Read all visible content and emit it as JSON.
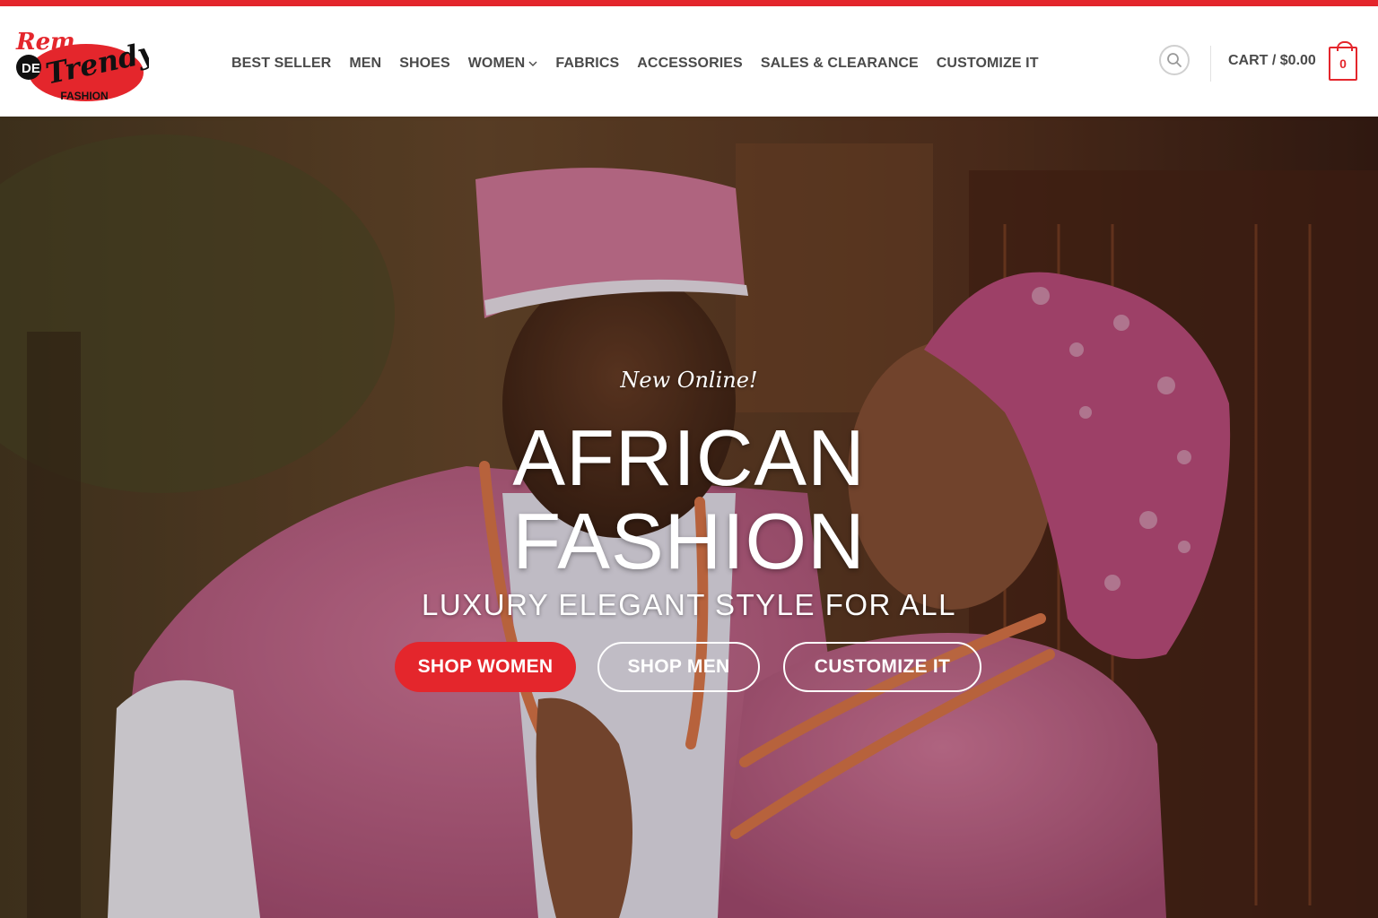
{
  "logo": {
    "line1": "Rem",
    "badge": "DE",
    "line2": "Trendy",
    "line3": "FASHION"
  },
  "nav": {
    "items": [
      {
        "label": "BEST SELLER"
      },
      {
        "label": "MEN"
      },
      {
        "label": "SHOES"
      },
      {
        "label": "WOMEN"
      },
      {
        "label": "FABRICS"
      },
      {
        "label": "ACCESSORIES"
      },
      {
        "label": "SALES & CLEARANCE"
      },
      {
        "label": "CUSTOMIZE IT"
      }
    ]
  },
  "header": {
    "cart_label": "CART / $0.00",
    "cart_count": "0"
  },
  "hero": {
    "tagline": "New Online!",
    "headline_line1": "AFRICAN",
    "headline_line2": "FASHION",
    "subline": "LUXURY ELEGANT STYLE FOR ALL",
    "buttons": {
      "shop_women": "SHOP WOMEN",
      "shop_men": "SHOP MEN",
      "customize": "CUSTOMIZE IT"
    }
  },
  "colors": {
    "accent": "#e4262c",
    "nav_text": "#4a4a4a",
    "hero_text": "#ffffff",
    "outfit_pink": "#c96a8f"
  },
  "icons": [
    "search-icon",
    "chevron-down-icon",
    "cart-bag-icon"
  ]
}
